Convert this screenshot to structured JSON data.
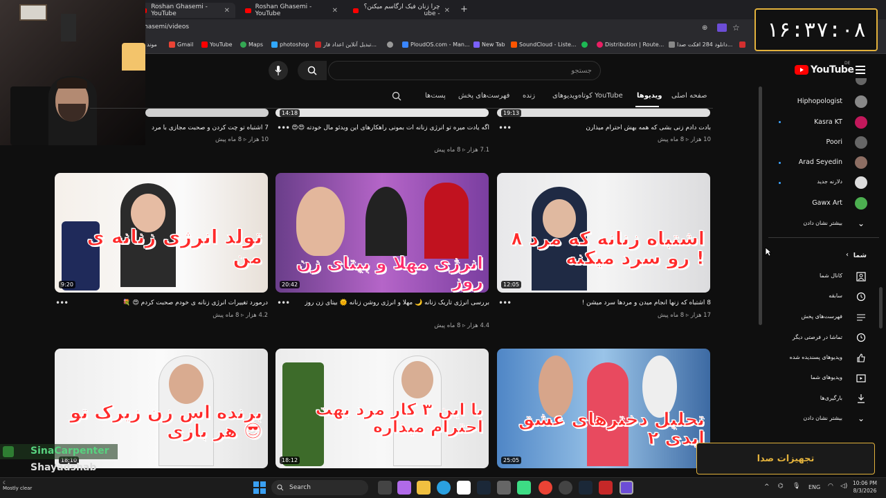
{
  "browser": {
    "tabs": [
      {
        "label": "Roshan Ghasemi - YouTube"
      },
      {
        "label": "Roshan Ghasemi - YouTube"
      },
      {
        "label": "چرا زنان فیک ارگاسم میکنن؟ - ube"
      }
    ],
    "new_tab": "+",
    "url": "hasemi/videos",
    "bookmarks": [
      {
        "label": "موند",
        "color": "#888"
      },
      {
        "label": "Gmail",
        "color": "#ea4335"
      },
      {
        "label": "YouTube",
        "color": "#ff0000"
      },
      {
        "label": "Maps",
        "color": "#34a853"
      },
      {
        "label": "photoshop",
        "color": "#31a8ff"
      },
      {
        "label": "تبدیل آنلاین اعداد فار...",
        "color": "#c62828"
      },
      {
        "label": "",
        "color": "#999"
      },
      {
        "label": "PloudOS.com - Man...",
        "color": "#3a86ff"
      },
      {
        "label": "New Tab",
        "color": "#7b61ff"
      },
      {
        "label": "SoundCloud - Liste...",
        "color": "#ff5500"
      },
      {
        "label": "",
        "color": "#1db954"
      },
      {
        "label": "Distribution | Route...",
        "color": "#e91e63"
      },
      {
        "label": "دانلود 284 افکت صدا...",
        "color": "#888"
      },
      {
        "label": "",
        "color": "#d32f2f"
      }
    ]
  },
  "clock": {
    "text": "۱۶:۳۷:۰۸"
  },
  "youtube": {
    "logo": "YouTube",
    "region": "DE",
    "search_placeholder": "جستجو",
    "channel_tabs": [
      "صفحه اصلی",
      "ویدیوها",
      "کوتاه‌ویدیوهای YouTube",
      "زنده",
      "فهرست‌های پخش",
      "پست‌ها"
    ],
    "active_tab": "ویدیوها",
    "top_row": [
      {
        "title": "بادت دادم زنی بشی که همه بهش احترام میذارن",
        "views": "10 هزار",
        "age": "8 ماه پیش",
        "duration": "19:13"
      },
      {
        "title": "اگه یادت میره تو انرژی زنانه ات بمونی راهکارهای این ویدئو مال خودته 😍😍",
        "views": "7.1 هزار",
        "age": "8 ماه پیش",
        "duration": "14:18"
      },
      {
        "title": "7 اشتباه تو چت کردن و صحبت مجازی با مرد",
        "views": "10 هزار",
        "age": "8 ماه پیش",
        "duration": ""
      }
    ],
    "videos": [
      {
        "title": "8 اشتباه که زنها انجام میدن و مردها سرد میشن !",
        "views": "17 هزار",
        "age": "8 ماه پیش",
        "duration": "12:05",
        "caption": "۸ اشتباه زنانه که مرد رو سرد میکنه !"
      },
      {
        "title": "بررسی انرژی تاریک زنانه 🌙 مهلا و انرژی روشن زنانه 🌞 بیتای زن روز",
        "views": "4.4 هزار",
        "age": "8 ماه پیش",
        "duration": "20:42",
        "caption": "انرژی مهلا و بیتای زن روز"
      },
      {
        "title": "درمورد تغییرات انرژی زنانه ی خودم صحبت کردم 😍 💐",
        "views": "4.2 هزار",
        "age": "8 ماه پیش",
        "duration": "9:20",
        "caption": "تولد انرژی زنانه ی من"
      },
      {
        "title": "",
        "views": "",
        "age": "",
        "duration": "25:05",
        "caption": "تحلیل دخترهای عشق ابدی ۲"
      },
      {
        "title": "",
        "views": "",
        "age": "",
        "duration": "18:12",
        "caption": "با این ۳ کار مرد بهت احترام میذاره"
      },
      {
        "title": "",
        "views": "",
        "age": "",
        "duration": "18:10",
        "caption": "برنده اس زن زیرک تو هر بازی 😎"
      }
    ],
    "subscriptions": [
      {
        "name": "Hiphopologist",
        "color": "#888",
        "new": false
      },
      {
        "name": "Kasra KT",
        "color": "#c2185b",
        "new": true
      },
      {
        "name": "Poori",
        "color": "#666",
        "new": false
      },
      {
        "name": "Arad Seyedin",
        "color": "#8d6e63",
        "new": true
      },
      {
        "name": "دلارنه جدید",
        "color": "#ddd",
        "new": true
      },
      {
        "name": "Gawx Art",
        "color": "#4caf50",
        "new": false
      }
    ],
    "show_more_subs": "بیشتر نشان دادن",
    "you_section": "شما",
    "you_items": [
      {
        "label": "کانال شما",
        "icon": "person-icon"
      },
      {
        "label": "سابقه",
        "icon": "history-icon"
      },
      {
        "label": "فهرست‌های پخش",
        "icon": "playlist-icon"
      },
      {
        "label": "تماشا در فرصتی دیگر",
        "icon": "clock-icon"
      },
      {
        "label": "ویدیوهای پسندیده شده",
        "icon": "like-icon"
      },
      {
        "label": "ویدیوهای شما",
        "icon": "video-icon"
      },
      {
        "label": "بارگیری‌ها",
        "icon": "download-icon"
      },
      {
        "label": "بیشتر نشان دادن",
        "icon": "chevron-down-icon"
      }
    ]
  },
  "overlay": {
    "sound_settings": "تجهیزات صدا"
  },
  "chat": [
    {
      "name": "SinaCarpenter"
    },
    {
      "name": "Shayadshab"
    }
  ],
  "taskbar": {
    "search": "Search",
    "lang": "ENG",
    "time": "10:06 PM",
    "date": "8/3/2026",
    "weather": "Mostly clear"
  }
}
